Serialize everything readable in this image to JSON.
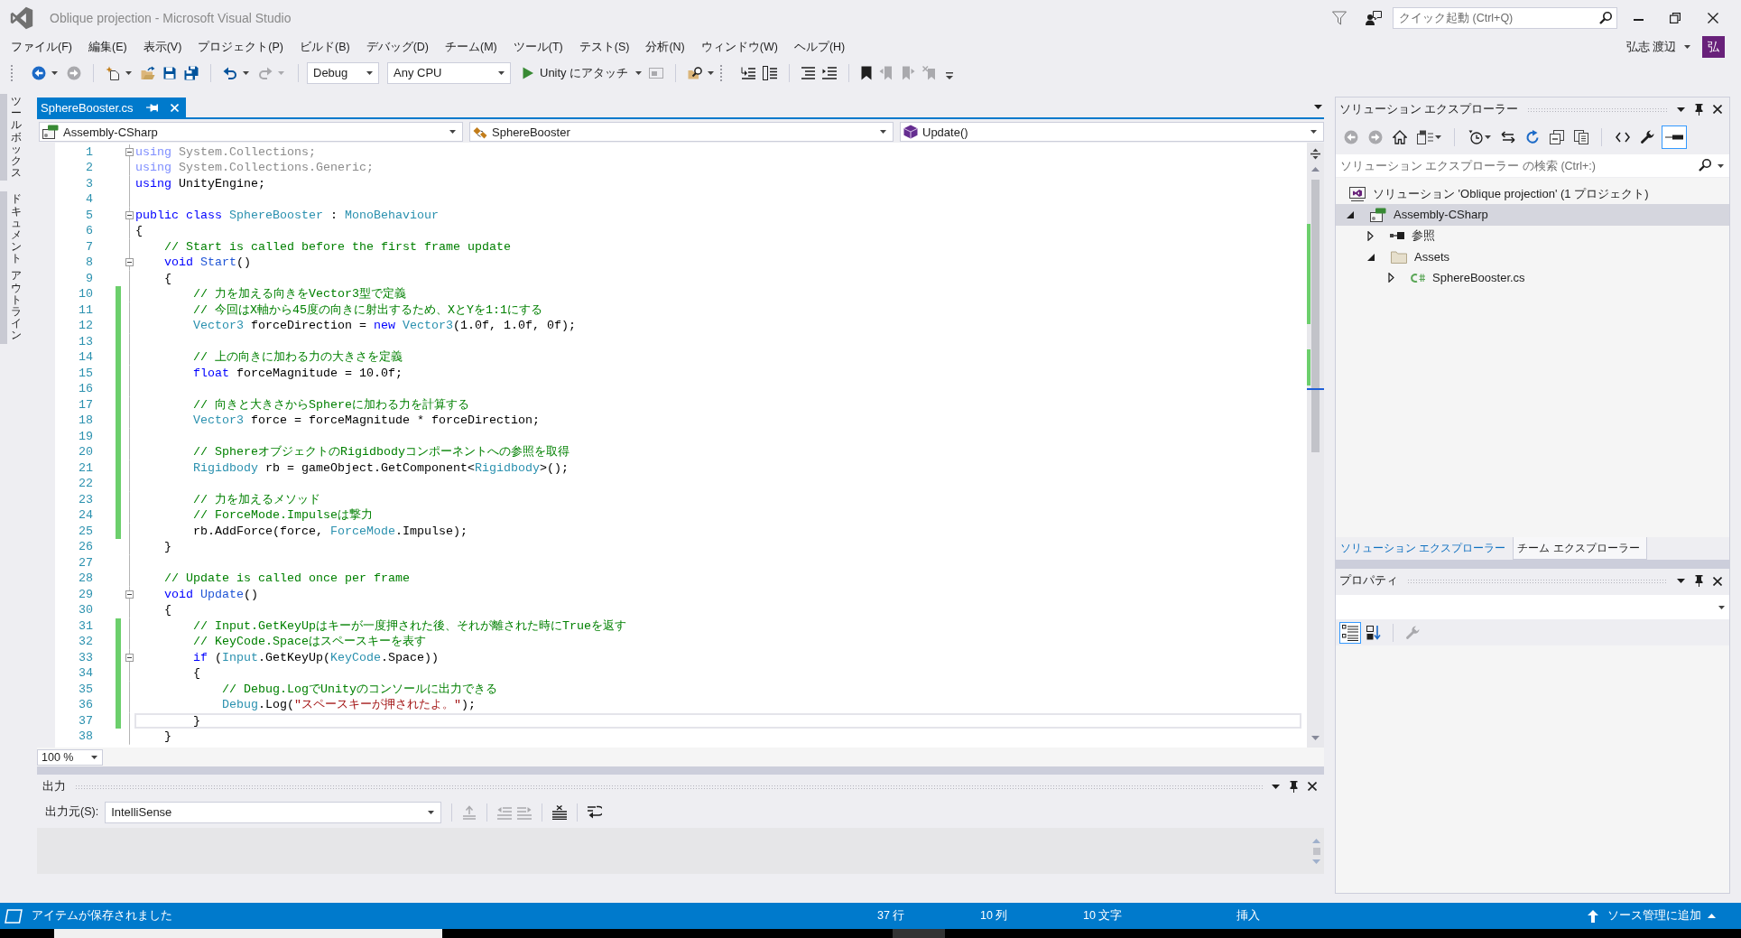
{
  "window": {
    "title": "Oblique projection - Microsoft Visual Studio"
  },
  "quick_launch": {
    "placeholder": "クイック起動 (Ctrl+Q)"
  },
  "menu": [
    "ファイル(F)",
    "編集(E)",
    "表示(V)",
    "プロジェクト(P)",
    "ビルド(B)",
    "デバッグ(D)",
    "チーム(M)",
    "ツール(T)",
    "テスト(S)",
    "分析(N)",
    "ウィンドウ(W)",
    "ヘルプ(H)"
  ],
  "account": {
    "name": "弘志 渡辺",
    "initial": "弘"
  },
  "toolbar": [
    {
      "kind": "split",
      "disabled": false
    },
    {
      "kind": "button",
      "disabled": true
    },
    {
      "kind": "separator"
    },
    {
      "kind": "split",
      "disabled": false
    },
    {
      "kind": "button",
      "disabled": false
    },
    {
      "kind": "button",
      "disabled": false
    },
    {
      "kind": "button",
      "disabled": false
    },
    {
      "kind": "separator"
    },
    {
      "kind": "split",
      "disabled": false
    },
    {
      "kind": "split",
      "disabled": true
    },
    {
      "kind": "separator"
    },
    {
      "kind": "combo",
      "value": "Debug"
    },
    {
      "kind": "combo",
      "value": "Any CPU"
    },
    {
      "kind": "run",
      "label": "Unity にアタッチ"
    },
    {
      "kind": "button",
      "disabled": true
    },
    {
      "kind": "separator"
    },
    {
      "kind": "split",
      "disabled": false
    },
    {
      "kind": "grip"
    },
    {
      "kind": "button",
      "disabled": false
    },
    {
      "kind": "button",
      "disabled": false
    },
    {
      "kind": "separator"
    },
    {
      "kind": "button",
      "disabled": false
    },
    {
      "kind": "button",
      "disabled": false
    },
    {
      "kind": "separator"
    },
    {
      "kind": "button",
      "disabled": false
    },
    {
      "kind": "button",
      "disabled": true
    },
    {
      "kind": "button",
      "disabled": true
    },
    {
      "kind": "button",
      "disabled": true
    },
    {
      "kind": "overflow"
    }
  ],
  "side_tabs": [
    [
      "ツールボックス"
    ],
    [
      "ドキュメント",
      "アウトライン"
    ]
  ],
  "editor": {
    "tabs": [
      {
        "label": "SphereBooster.cs",
        "selected": true
      }
    ],
    "navigation": [
      {
        "kind": "project",
        "text": "Assembly-CSharp"
      },
      {
        "kind": "class",
        "text": "SphereBooster"
      },
      {
        "kind": "method",
        "text": "Update()"
      }
    ],
    "lines": [
      {
        "number": "1",
        "changed": false,
        "current": false,
        "expanded": true,
        "tokens": [
          {
            "kind": "faded_keyword",
            "text": "using"
          },
          {
            "kind": "faded",
            "text": " System.Collections;"
          }
        ]
      },
      {
        "number": "2",
        "changed": false,
        "current": false,
        "tokens": [
          {
            "kind": "faded_keyword",
            "text": "using"
          },
          {
            "kind": "faded",
            "text": " System.Collections.Generic;"
          }
        ]
      },
      {
        "number": "3",
        "changed": false,
        "current": false,
        "tokens": [
          {
            "kind": "keyword",
            "text": "using"
          },
          {
            "kind": "plain",
            "text": " UnityEngine;"
          }
        ]
      },
      {
        "number": "4",
        "changed": false,
        "current": false
      },
      {
        "number": "5",
        "changed": false,
        "current": false,
        "expanded": true,
        "tokens": [
          {
            "kind": "keyword",
            "text": "public class "
          },
          {
            "kind": "type",
            "text": "SphereBooster"
          },
          {
            "kind": "plain",
            "text": " : "
          },
          {
            "kind": "type",
            "text": "MonoBehaviour"
          }
        ]
      },
      {
        "number": "6",
        "changed": false,
        "current": false,
        "tokens": [
          {
            "kind": "plain",
            "text": "{"
          }
        ]
      },
      {
        "number": "7",
        "changed": false,
        "current": false,
        "tokens": [
          {
            "kind": "comment",
            "text": "    // Start is called before the first frame update"
          }
        ]
      },
      {
        "number": "8",
        "changed": false,
        "current": false,
        "expanded": true,
        "tokens": [
          {
            "kind": "keyword",
            "text": "    void "
          },
          {
            "kind": "message",
            "text": "Start"
          },
          {
            "kind": "plain",
            "text": "()"
          }
        ]
      },
      {
        "number": "9",
        "changed": false,
        "current": false,
        "tokens": [
          {
            "kind": "plain",
            "text": "    {"
          }
        ]
      },
      {
        "number": "10",
        "changed": true,
        "current": false,
        "tokens": [
          {
            "kind": "comment",
            "text": "        // 力を加える向きをVector3型で定義"
          }
        ]
      },
      {
        "number": "11",
        "changed": true,
        "current": false,
        "tokens": [
          {
            "kind": "comment",
            "text": "        // 今回はX軸から45度の向きに射出するため、XとYを1:1にする"
          }
        ]
      },
      {
        "number": "12",
        "changed": true,
        "current": false,
        "tokens": [
          {
            "kind": "type",
            "text": "        Vector3"
          },
          {
            "kind": "plain",
            "text": " forceDirection = "
          },
          {
            "kind": "keyword",
            "text": "new "
          },
          {
            "kind": "type",
            "text": "Vector3"
          },
          {
            "kind": "plain",
            "text": "(1.0f, 1.0f, 0f);"
          }
        ]
      },
      {
        "number": "13",
        "changed": true,
        "current": false
      },
      {
        "number": "14",
        "changed": true,
        "current": false,
        "tokens": [
          {
            "kind": "comment",
            "text": "        // 上の向きに加わる力の大きさを定義"
          }
        ]
      },
      {
        "number": "15",
        "changed": true,
        "current": false,
        "tokens": [
          {
            "kind": "keyword",
            "text": "        float"
          },
          {
            "kind": "plain",
            "text": " forceMagnitude = 10.0f;"
          }
        ]
      },
      {
        "number": "16",
        "changed": true,
        "current": false
      },
      {
        "number": "17",
        "changed": true,
        "current": false,
        "tokens": [
          {
            "kind": "comment",
            "text": "        // 向きと大きさからSphereに加わる力を計算する"
          }
        ]
      },
      {
        "number": "18",
        "changed": true,
        "current": false,
        "tokens": [
          {
            "kind": "type",
            "text": "        Vector3"
          },
          {
            "kind": "plain",
            "text": " force = forceMagnitude * forceDirection;"
          }
        ]
      },
      {
        "number": "19",
        "changed": true,
        "current": false
      },
      {
        "number": "20",
        "changed": true,
        "current": false,
        "tokens": [
          {
            "kind": "comment",
            "text": "        // SphereオブジェクトのRigidbodyコンポーネントへの参照を取得"
          }
        ]
      },
      {
        "number": "21",
        "changed": true,
        "current": false,
        "tokens": [
          {
            "kind": "type",
            "text": "        Rigidbody"
          },
          {
            "kind": "plain",
            "text": " rb = gameObject.GetComponent<"
          },
          {
            "kind": "type",
            "text": "Rigidbody"
          },
          {
            "kind": "plain",
            "text": ">();"
          }
        ]
      },
      {
        "number": "22",
        "changed": true,
        "current": false
      },
      {
        "number": "23",
        "changed": true,
        "current": false,
        "tokens": [
          {
            "kind": "comment",
            "text": "        // 力を加えるメソッド"
          }
        ]
      },
      {
        "number": "24",
        "changed": true,
        "current": false,
        "tokens": [
          {
            "kind": "comment",
            "text": "        // ForceMode.Impulseは撃力"
          }
        ]
      },
      {
        "number": "25",
        "changed": true,
        "current": false,
        "tokens": [
          {
            "kind": "plain",
            "text": "        rb.AddForce(force, "
          },
          {
            "kind": "type",
            "text": "ForceMode"
          },
          {
            "kind": "plain",
            "text": ".Impulse);"
          }
        ]
      },
      {
        "number": "26",
        "changed": false,
        "current": false,
        "tokens": [
          {
            "kind": "plain",
            "text": "    }"
          }
        ]
      },
      {
        "number": "27",
        "changed": false,
        "current": false
      },
      {
        "number": "28",
        "changed": false,
        "current": false,
        "tokens": [
          {
            "kind": "comment",
            "text": "    // Update is called once per frame"
          }
        ]
      },
      {
        "number": "29",
        "changed": false,
        "current": false,
        "expanded": true,
        "tokens": [
          {
            "kind": "keyword",
            "text": "    void "
          },
          {
            "kind": "message",
            "text": "Update"
          },
          {
            "kind": "plain",
            "text": "()"
          }
        ]
      },
      {
        "number": "30",
        "changed": false,
        "current": false,
        "tokens": [
          {
            "kind": "plain",
            "text": "    {"
          }
        ]
      },
      {
        "number": "31",
        "changed": true,
        "current": false,
        "tokens": [
          {
            "kind": "comment",
            "text": "        // Input.GetKeyUpはキーが一度押された後、それが離された時にTrueを返す"
          }
        ]
      },
      {
        "number": "32",
        "changed": true,
        "current": false,
        "tokens": [
          {
            "kind": "comment",
            "text": "        // KeyCode.Spaceはスペースキーを表す"
          }
        ]
      },
      {
        "number": "33",
        "changed": true,
        "current": false,
        "expanded": true,
        "tokens": [
          {
            "kind": "keyword",
            "text": "        if"
          },
          {
            "kind": "plain",
            "text": " ("
          },
          {
            "kind": "type",
            "text": "Input"
          },
          {
            "kind": "plain",
            "text": ".GetKeyUp("
          },
          {
            "kind": "type",
            "text": "KeyCode"
          },
          {
            "kind": "plain",
            "text": ".Space))"
          }
        ]
      },
      {
        "number": "34",
        "changed": true,
        "current": false,
        "tokens": [
          {
            "kind": "plain",
            "text": "        {"
          }
        ]
      },
      {
        "number": "35",
        "changed": true,
        "current": false,
        "tokens": [
          {
            "kind": "comment",
            "text": "            // Debug.LogでUnityのコンソールに出力できる"
          }
        ]
      },
      {
        "number": "36",
        "changed": true,
        "current": false,
        "tokens": [
          {
            "kind": "type",
            "text": "            Debug"
          },
          {
            "kind": "plain",
            "text": ".Log("
          },
          {
            "kind": "string",
            "text": "\"スペースキーが押されたよ。\""
          },
          {
            "kind": "plain",
            "text": ");"
          }
        ]
      },
      {
        "number": "37",
        "changed": true,
        "current": true,
        "tokens": [
          {
            "kind": "plain",
            "text": "        }"
          }
        ]
      },
      {
        "number": "38",
        "changed": false,
        "current": false,
        "tokens": [
          {
            "kind": "plain",
            "text": "    }"
          }
        ]
      }
    ],
    "zoom": "100 %"
  },
  "output": {
    "title": "出力",
    "source_label": "出力元(S):",
    "source": "IntelliSense",
    "toolbar": [
      {
        "kind": "separator"
      },
      {
        "kind": "button",
        "disabled": true
      },
      {
        "kind": "separator"
      },
      {
        "kind": "button",
        "disabled": true
      },
      {
        "kind": "button",
        "disabled": true
      },
      {
        "kind": "separator"
      },
      {
        "kind": "button",
        "disabled": false
      },
      {
        "kind": "separator"
      },
      {
        "kind": "button",
        "disabled": false
      }
    ]
  },
  "solution_explorer": {
    "title": "ソリューション エクスプローラー",
    "toolbar": [
      {
        "kind": "button",
        "disabled": true,
        "selected": false
      },
      {
        "kind": "button",
        "disabled": true,
        "selected": false
      },
      {
        "kind": "button",
        "disabled": false,
        "selected": false
      },
      {
        "kind": "split",
        "disabled": false,
        "selected": false
      },
      {
        "kind": "separator"
      },
      {
        "kind": "split",
        "disabled": false,
        "selected": false
      },
      {
        "kind": "button",
        "disabled": false,
        "selected": false
      },
      {
        "kind": "button",
        "disabled": false,
        "selected": false
      },
      {
        "kind": "button",
        "disabled": false,
        "selected": false
      },
      {
        "kind": "button",
        "disabled": false,
        "selected": false
      },
      {
        "kind": "separator"
      },
      {
        "kind": "button",
        "disabled": false,
        "selected": false
      },
      {
        "kind": "button",
        "disabled": false,
        "selected": false
      },
      {
        "kind": "button",
        "disabled": false,
        "selected": true
      }
    ],
    "search": {
      "placeholder": "ソリューション エクスプローラー の検索 (Ctrl+:)"
    },
    "tree": [
      {
        "kind": "solution",
        "label": "ソリューション 'Oblique projection' (1 プロジェクト)",
        "selected": false,
        "children": [
          {
            "kind": "project",
            "label": "Assembly-CSharp",
            "selected": true,
            "expanded": true,
            "children": [
              {
                "kind": "references",
                "label": "参照",
                "selected": false,
                "expanded": false
              },
              {
                "kind": "folder",
                "label": "Assets",
                "selected": false,
                "expanded": true,
                "children": [
                  {
                    "kind": "csharp",
                    "label": "SphereBooster.cs",
                    "selected": false,
                    "expanded": false
                  }
                ]
              }
            ]
          }
        ]
      }
    ],
    "tabs": [
      {
        "label": "ソリューション エクスプローラー",
        "selected": true
      },
      {
        "label": "チーム エクスプローラー",
        "selected": false
      }
    ]
  },
  "properties": {
    "title": "プロパティ",
    "toolbar": [
      {
        "kind": "button",
        "disabled": false,
        "selected": true
      },
      {
        "kind": "button",
        "disabled": false,
        "selected": false
      },
      {
        "kind": "separator"
      },
      {
        "kind": "button",
        "disabled": true,
        "selected": false
      }
    ]
  },
  "status_bar": {
    "message": "アイテムが保存されました",
    "line": "37 行",
    "column": "10 列",
    "character": "10 文字",
    "mode": "挿入",
    "source_control": "ソース管理に追加"
  }
}
